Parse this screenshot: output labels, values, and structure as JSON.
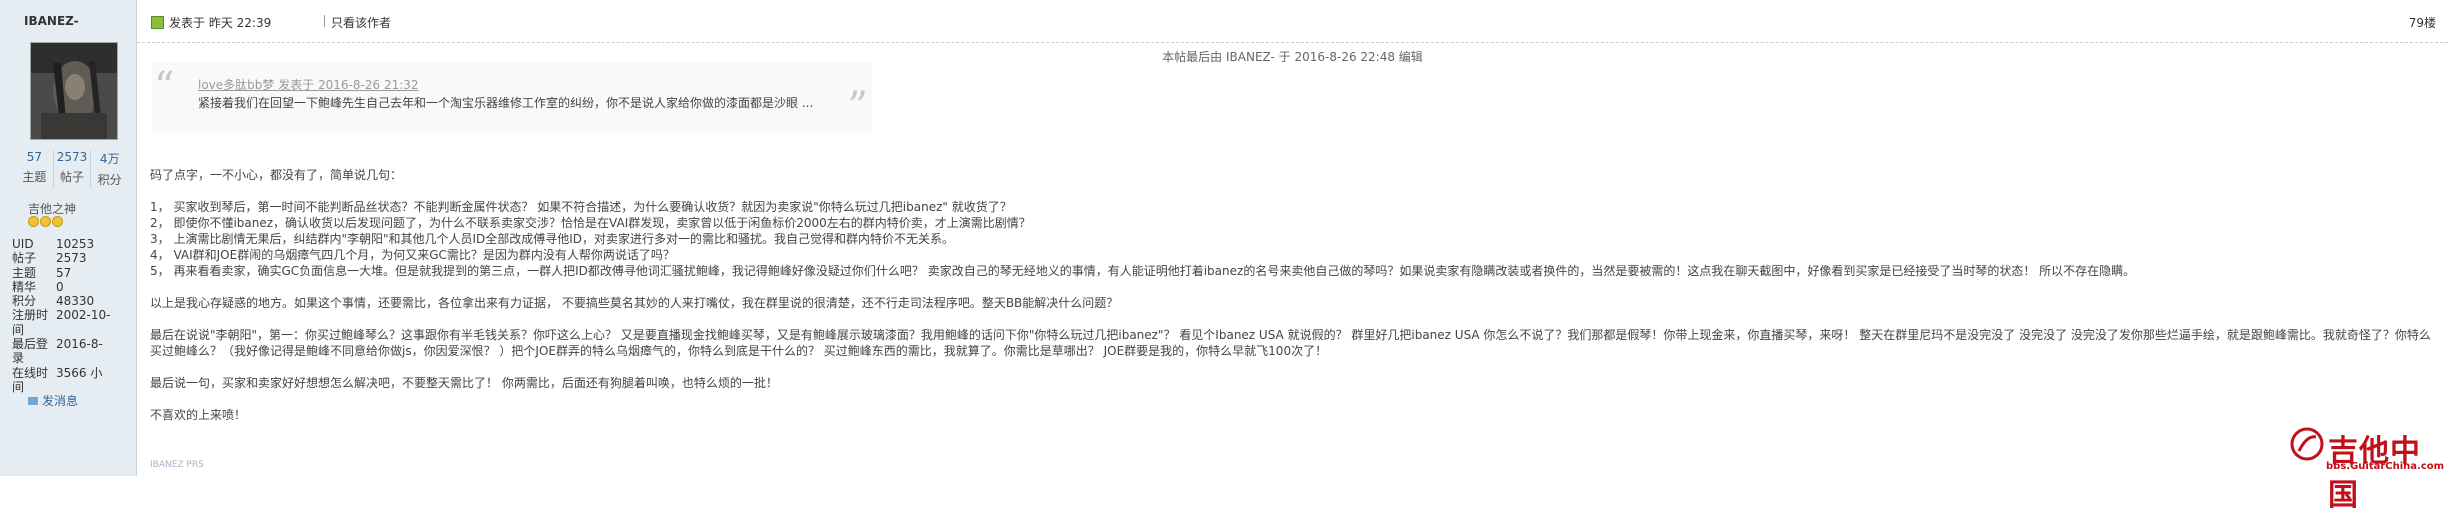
{
  "user": {
    "name": "IBANEZ-",
    "stats": [
      {
        "value": "57",
        "label": "主题"
      },
      {
        "value": "2573",
        "label": "帖子"
      },
      {
        "value": "4万",
        "label": "积分"
      }
    ],
    "group": "吉他之神",
    "info": [
      {
        "key": "UID",
        "value": "10253"
      },
      {
        "key": "帖子",
        "value": "2573"
      },
      {
        "key": "主题",
        "value": "57"
      },
      {
        "key": "精华",
        "value": "0"
      },
      {
        "key": "积分",
        "value": "48330"
      },
      {
        "key": "注册时间",
        "value": "2002-10-"
      },
      {
        "key": "最后登录",
        "value": "2016-8-"
      },
      {
        "key": "在线时间",
        "value": "3566 小"
      }
    ],
    "pm_label": "发消息"
  },
  "post": {
    "posted": "发表于 昨天 22:39",
    "author_only": "只看该作者",
    "floor": "79楼",
    "edited": "本帖最后由 IBANEZ- 于 2016-8-26 22:48 编辑",
    "quote_head": "love多肽bb梦 发表于 2016-8-26 21:32",
    "quote_body": "紧接着我们在回望一下鲍峰先生自己去年和一个淘宝乐器维修工作室的纠纷，你不是说人家给你做的漆面都是沙眼 ...",
    "paragraphs": [
      "码了点字，一不小心，都没有了，简单说几句：",
      "",
      "1，  买家收到琴后，第一时间不能判断品丝状态？不能判断金属件状态？ 如果不符合描述，为什么要确认收货？就因为卖家说\"你特么玩过几把ibanez\" 就收货了？",
      "2，  即使你不懂ibanez，确认收货以后发现问题了，为什么不联系卖家交涉？恰恰是在VAI群发现，卖家曾以低于闲鱼标价2000左右的群内特价卖，才上演需比剧情？",
      "3，  上演需比剧情无果后，纠结群内\"李朝阳\"和其他几个人员ID全部改成傅寻他ID，对卖家进行多对一的需比和骚扰。我自己觉得和群内特价不无关系。",
      "4，  VAI群和JOE群闹的乌烟瘴气四几个月，为何又来GC需比？是因为群内没有人帮你两说话了吗？",
      "5，  再来看看卖家，确实GC负面信息一大堆。但是就我提到的第三点，一群人把ID都改傅寻他词汇骚扰鲍峰，我记得鲍峰好像没疑过你们什么吧？ 卖家改自己的琴无经地义的事情，有人能证明他打着ibanez的名号来卖他自己做的琴吗？如果说卖家有隐瞒改装或者换件的，当然是要被需的！这点我在聊天截图中，好像看到买家是已经接受了当时琴的状态！ 所以不存在隐瞒。",
      "",
      "以上是我心存疑惑的地方。如果这个事情，还要需比，各位拿出来有力证据，  不要搞些莫名其妙的人来打嘴仗，我在群里说的很清楚，还不行走司法程序吧。整天BB能解决什么问题？",
      "",
      "最后在说说\"李朝阳\"，第一：你买过鲍峰琴么？这事跟你有半毛钱关系？你吓这么上心？ 又是要直播现金找鲍峰买琴，又是有鲍峰展示玻璃漆面？我用鲍峰的话问下你\"你特么玩过几把ibanez\"？ 看见个Ibanez USA 就说假的？ 群里好几把ibanez USA 你怎么不说了？我们那都是假琴！你带上现金来，你直播买琴，来呀！ 整天在群里尼玛不是没完没了 没完没了 没完没了发你那些烂逼手绘，就是跟鲍峰需比。我就奇怪了？你特么买过鲍峰么？（我好像记得是鲍峰不同意给你做js，你因爱深恨？ ）把个JOE群弄的特么乌烟瘴气的，你特么到底是干什么的？ 买过鲍峰东西的需比，我就算了。你需比是草哪出？ JOE群要是我的，你特么早就飞100次了！",
      "",
      "最后说一句，买家和卖家好好想想怎么解决吧，不要整天需比了！ 你两需比，后面还有狗腿着叫唤，也特么烦的一批！",
      "",
      "不喜欢的上来喷！"
    ],
    "signature": "IBANEZ PRS"
  },
  "watermark": {
    "cn": "吉他中国",
    "url": "bbs.GuitarChina.com"
  }
}
